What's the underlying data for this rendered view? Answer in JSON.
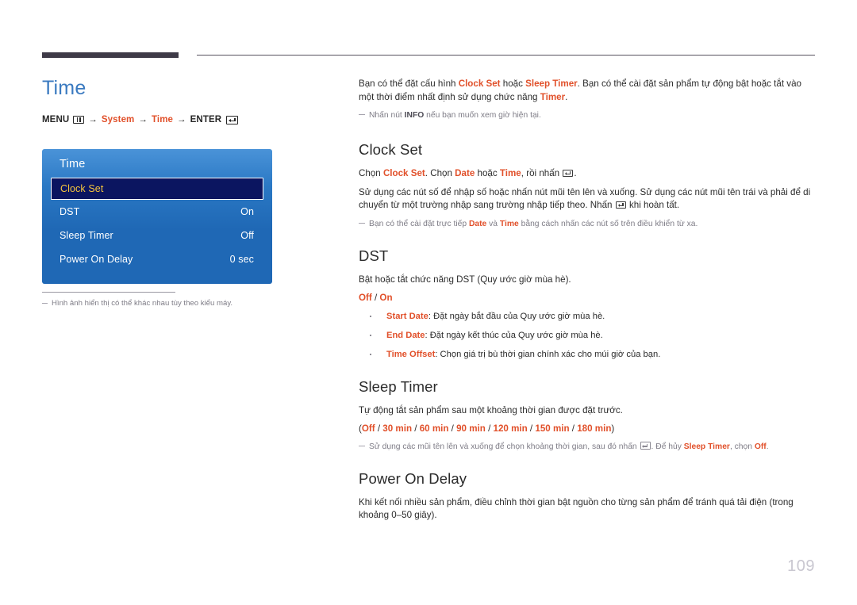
{
  "page": {
    "number": "109",
    "title": "Time"
  },
  "breadcrumb": {
    "menu_label": "MENU",
    "menu_icon": "menu-bars-icon",
    "arrow": "→",
    "item1": "System",
    "item2": "Time",
    "enter_label": "ENTER",
    "enter_icon": "enter-key-icon"
  },
  "osd": {
    "title": "Time",
    "rows": [
      {
        "label": "Clock Set",
        "value": "",
        "selected": true
      },
      {
        "label": "DST",
        "value": "On",
        "selected": false
      },
      {
        "label": "Sleep Timer",
        "value": "Off",
        "selected": false
      },
      {
        "label": "Power On Delay",
        "value": "0 sec",
        "selected": false
      }
    ]
  },
  "left_note": "Hình ảnh hiển thị có thể khác nhau tùy theo kiểu máy.",
  "intro": {
    "p1_a": "Bạn có thể đặt cấu hình ",
    "p1_h1": "Clock Set",
    "p1_b": " hoặc ",
    "p1_h2": "Sleep Timer",
    "p1_c": ". Bạn có thể cài đặt sản phẩm tự động bật hoặc tắt vào một thời điểm nhất định sử dụng chức năng ",
    "p1_h3": "Timer",
    "p1_d": ".",
    "tip_a": "Nhấn nút ",
    "tip_strong": "INFO",
    "tip_b": " nếu bạn muốn xem giờ hiện tại."
  },
  "clock_set": {
    "heading": "Clock Set",
    "p1_a": "Chọn ",
    "p1_h1": "Clock Set",
    "p1_b": ". Chọn ",
    "p1_h2": "Date",
    "p1_c": " hoặc ",
    "p1_h3": "Time",
    "p1_d": ", rồi nhấn ",
    "p1_e": ".",
    "p2_a": "Sử dụng các nút số để nhập số hoặc nhấn nút mũi tên lên và xuống. Sử dụng các nút mũi tên trái và phải để di chuyển từ một trường nhập sang trường nhập tiếp theo. Nhấn ",
    "p2_b": " khi hoàn tất.",
    "tip_a": "Bạn có thể cài đặt trực tiếp ",
    "tip_h1": "Date",
    "tip_b": " và ",
    "tip_h2": "Time",
    "tip_c": " bằng cách nhấn các nút số trên điều khiển từ xa."
  },
  "dst": {
    "heading": "DST",
    "p1": "Bật hoặc tắt chức năng DST (Quy ước giờ mùa hè).",
    "opt_off": "Off",
    "opt_sep": " / ",
    "opt_on": "On",
    "bullets": [
      {
        "term": "Start Date",
        "desc": ": Đặt ngày bắt đầu của Quy ước giờ mùa hè."
      },
      {
        "term": "End Date",
        "desc": ": Đặt ngày kết thúc của Quy ước giờ mùa hè."
      },
      {
        "term": "Time Offset",
        "desc": ": Chọn giá trị bù thời gian chính xác cho múi giờ của bạn."
      }
    ]
  },
  "sleep_timer": {
    "heading": "Sleep Timer",
    "p1": "Tự động tắt sản phẩm sau một khoảng thời gian được đặt trước.",
    "open_paren": "(",
    "options": [
      "Off",
      "30 min",
      "60 min",
      "90 min",
      "120 min",
      "150 min",
      "180 min"
    ],
    "close_paren": ")",
    "tip_a": "Sử dụng các mũi tên lên và xuống để chọn khoảng thời gian, sau đó nhấn ",
    "tip_b": ". Để hủy ",
    "tip_h1": "Sleep Timer",
    "tip_c": ", chọn ",
    "tip_h2": "Off",
    "tip_d": "."
  },
  "power_on_delay": {
    "heading": "Power On Delay",
    "p1": "Khi kết nối nhiều sản phẩm, điều chỉnh thời gian bật nguồn cho từng sản phẩm để tránh quá tải điện (trong khoảng 0–50 giây)."
  },
  "colors": {
    "accent_orange": "#e1502a",
    "title_blue": "#3a7ac0",
    "osd_blue": "#1f68b5",
    "osd_selected_navy": "#0b1560",
    "osd_selected_text": "#f5c53d"
  }
}
